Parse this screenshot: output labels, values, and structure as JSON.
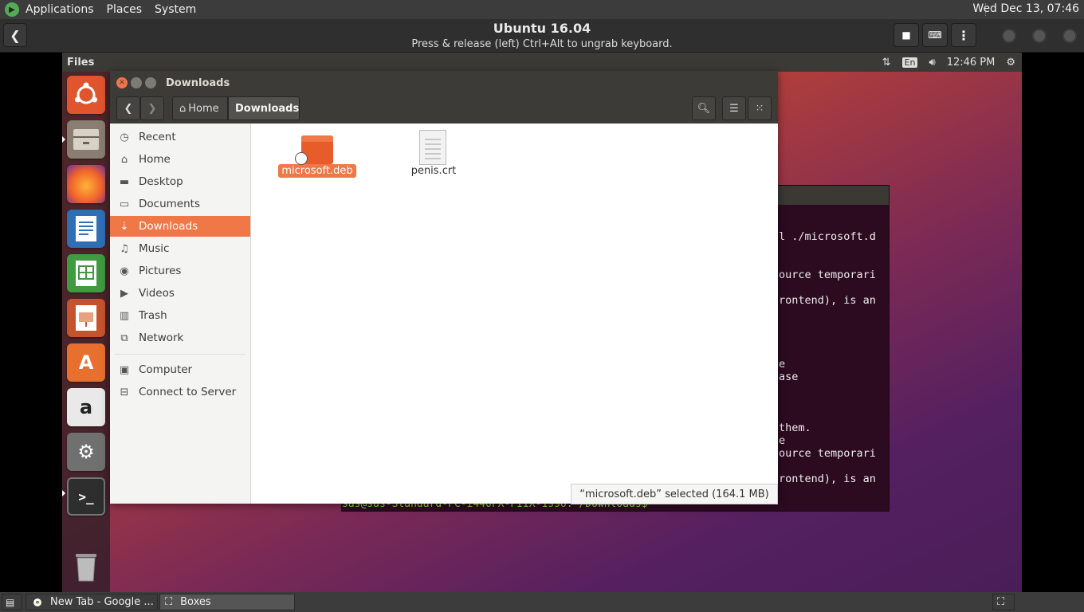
{
  "host_panel": {
    "menus": [
      "Applications",
      "Places",
      "System"
    ],
    "clock": "Wed Dec 13, 07:46"
  },
  "boxes": {
    "title": "Ubuntu 16.04",
    "subtitle": "Press & release (left) Ctrl+Alt to ungrab keyboard."
  },
  "guest_panel": {
    "app_title": "Files",
    "keyboard_layout": "En",
    "time": "12:46 PM"
  },
  "files": {
    "window_title": "Downloads",
    "breadcrumbs": [
      "Home",
      "Downloads"
    ],
    "sidebar": [
      {
        "label": "Recent",
        "icon": "clock-icon"
      },
      {
        "label": "Home",
        "icon": "home-icon"
      },
      {
        "label": "Desktop",
        "icon": "desktop-icon"
      },
      {
        "label": "Documents",
        "icon": "documents-icon"
      },
      {
        "label": "Downloads",
        "icon": "download-icon",
        "active": true
      },
      {
        "label": "Music",
        "icon": "music-icon"
      },
      {
        "label": "Pictures",
        "icon": "camera-icon"
      },
      {
        "label": "Videos",
        "icon": "video-icon"
      },
      {
        "label": "Trash",
        "icon": "trash-icon"
      },
      {
        "label": "Network",
        "icon": "network-icon"
      },
      {
        "label": "Computer",
        "icon": "computer-icon"
      },
      {
        "label": "Connect to Server",
        "icon": "server-icon"
      }
    ],
    "items": [
      {
        "name": "microsoft.deb",
        "selected": true
      },
      {
        "name": "penis.crt",
        "selected": false
      }
    ],
    "status": "“microsoft.deb” selected  (164.1 MB)"
  },
  "terminal": {
    "lines": [
      "l ./microsoft.d",
      "ource temporari",
      "rontend), is an",
      "e",
      "ase",
      "them.",
      "e",
      "ource temporari",
      "rontend), is an"
    ],
    "prompt": "sas@sas-Standard-PC-i440FX-PIIX-1996:~/Downloads$ "
  },
  "taskbar": {
    "tasks": [
      "New Tab - Google ...",
      "Boxes"
    ]
  }
}
